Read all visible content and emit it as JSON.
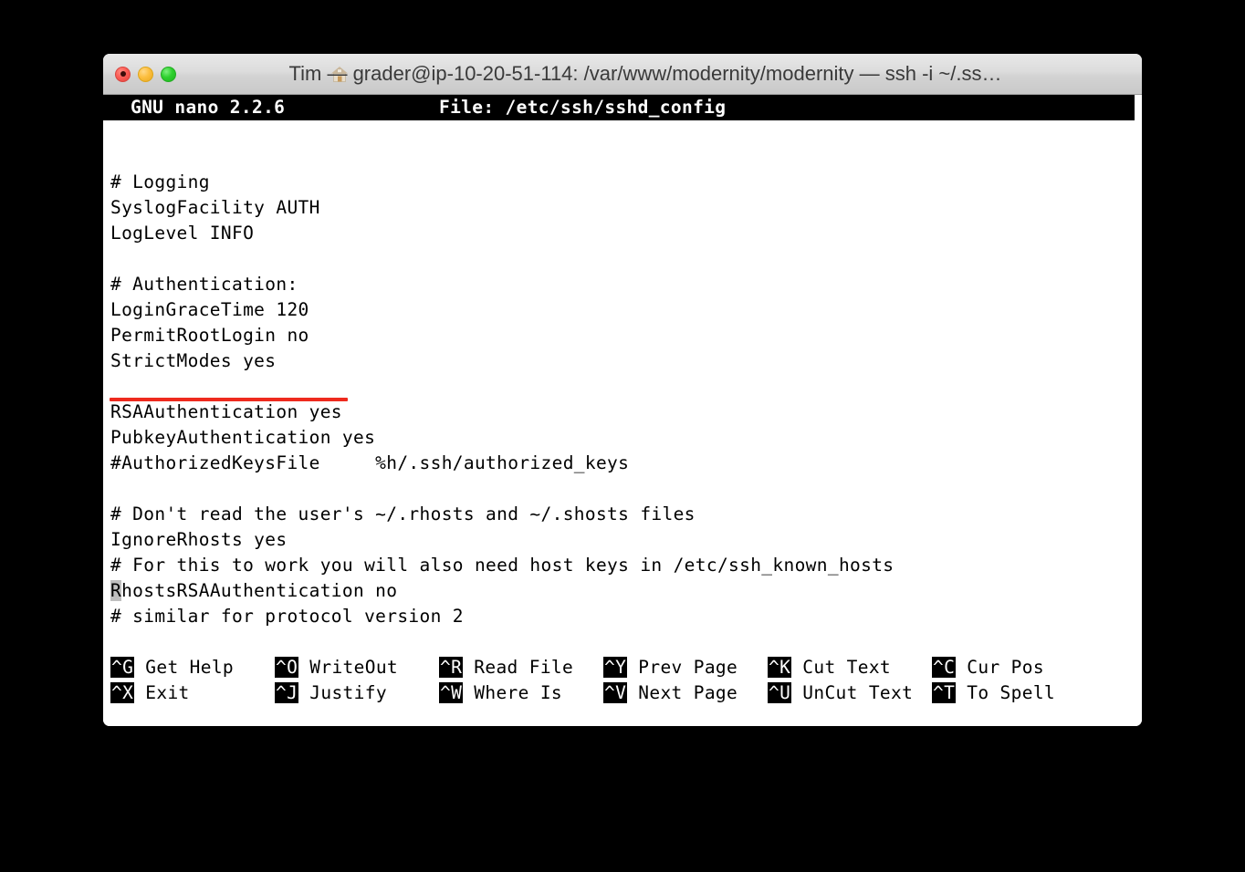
{
  "window": {
    "title": "Tim — grader@ip-10-20-51-114: /var/www/modernity/modernity — ssh -i ~/.ss…",
    "traffic_lights": {
      "close_label": "close",
      "minimize_label": "minimize",
      "zoom_label": "zoom"
    },
    "proxy_icon": "home-icon"
  },
  "nano": {
    "header": {
      "version": "GNU nano 2.2.6",
      "file": "File: /etc/ssh/sshd_config"
    },
    "lines": [
      "",
      "",
      "# Logging",
      "SyslogFacility AUTH",
      "LogLevel INFO",
      "",
      "# Authentication:",
      "LoginGraceTime 120",
      "PermitRootLogin no",
      "StrictModes yes",
      "",
      "RSAAuthentication yes",
      "PubkeyAuthentication yes",
      "#AuthorizedKeysFile     %h/.ssh/authorized_keys",
      "",
      "# Don't read the user's ~/.rhosts and ~/.shosts files",
      "IgnoreRhosts yes",
      "# For this to work you will also need host keys in /etc/ssh_known_hosts",
      "RhostsRSAAuthentication no",
      "# similar for protocol version 2"
    ],
    "cursor": {
      "line_index": 18,
      "char": "R",
      "rest": "hostsRSAAuthentication no"
    },
    "annotation": {
      "type": "underline",
      "color": "#ee2a1e",
      "target_line": "PermitRootLogin no"
    },
    "shortcuts_row1": [
      {
        "key": "^G",
        "label": "Get Help"
      },
      {
        "key": "^O",
        "label": "WriteOut"
      },
      {
        "key": "^R",
        "label": "Read File"
      },
      {
        "key": "^Y",
        "label": "Prev Page"
      },
      {
        "key": "^K",
        "label": "Cut Text"
      },
      {
        "key": "^C",
        "label": "Cur Pos"
      }
    ],
    "shortcuts_row2": [
      {
        "key": "^X",
        "label": "Exit"
      },
      {
        "key": "^J",
        "label": "Justify"
      },
      {
        "key": "^W",
        "label": "Where Is"
      },
      {
        "key": "^V",
        "label": "Next Page"
      },
      {
        "key": "^U",
        "label": "UnCut Text"
      },
      {
        "key": "^T",
        "label": "To Spell"
      }
    ]
  }
}
